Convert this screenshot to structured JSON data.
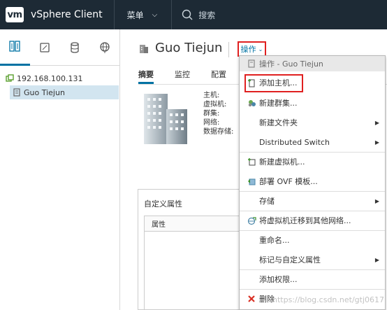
{
  "topbar": {
    "logo": "vm",
    "app_title": "vSphere Client",
    "menu_label": "菜单",
    "search_placeholder": "搜索"
  },
  "navigator": {
    "tabs": [
      "hosts-clusters-icon",
      "vms-templates-icon",
      "storage-icon",
      "networking-icon"
    ],
    "tree": {
      "datacenter": "192.168.100.131",
      "host": "Guo Tiejun"
    }
  },
  "object": {
    "name": "Guo Tiejun",
    "actions_label": "操作",
    "tabs": [
      "摘要",
      "监控",
      "配置"
    ],
    "properties": [
      "主机:",
      "虚拟机:",
      "群集:",
      "网络:",
      "数据存储:"
    ]
  },
  "custom_attributes": {
    "title": "自定义属性",
    "column": "属性"
  },
  "actions_menu": {
    "header": "操作 - Guo Tiejun",
    "items": [
      {
        "label": "添加主机...",
        "icon": "add-host-icon",
        "submenu": false
      },
      {
        "label": "新建群集...",
        "icon": "new-cluster-icon",
        "submenu": false
      },
      {
        "label": "新建文件夹",
        "icon": "",
        "submenu": true
      },
      {
        "label": "Distributed Switch",
        "icon": "",
        "submenu": true
      },
      {
        "label": "新建虚拟机...",
        "icon": "new-vm-icon",
        "submenu": false
      },
      {
        "label": "部署 OVF 模板...",
        "icon": "deploy-ovf-icon",
        "submenu": false
      },
      {
        "label": "存储",
        "icon": "",
        "submenu": true
      },
      {
        "label": "将虚拟机迁移到其他网络...",
        "icon": "migrate-network-icon",
        "submenu": false
      },
      {
        "label": "重命名...",
        "icon": "",
        "submenu": false
      },
      {
        "label": "标记与自定义属性",
        "icon": "",
        "submenu": true
      },
      {
        "label": "添加权限...",
        "icon": "",
        "submenu": false
      },
      {
        "label": "删除",
        "icon": "delete-icon",
        "submenu": false
      }
    ]
  },
  "watermark": "https://blog.csdn.net/gtj0617",
  "colors": {
    "topbar_bg": "#1d2a35",
    "accent": "#0072a3",
    "highlight_box": "#e02020",
    "selected_row": "#d2e5f0"
  }
}
